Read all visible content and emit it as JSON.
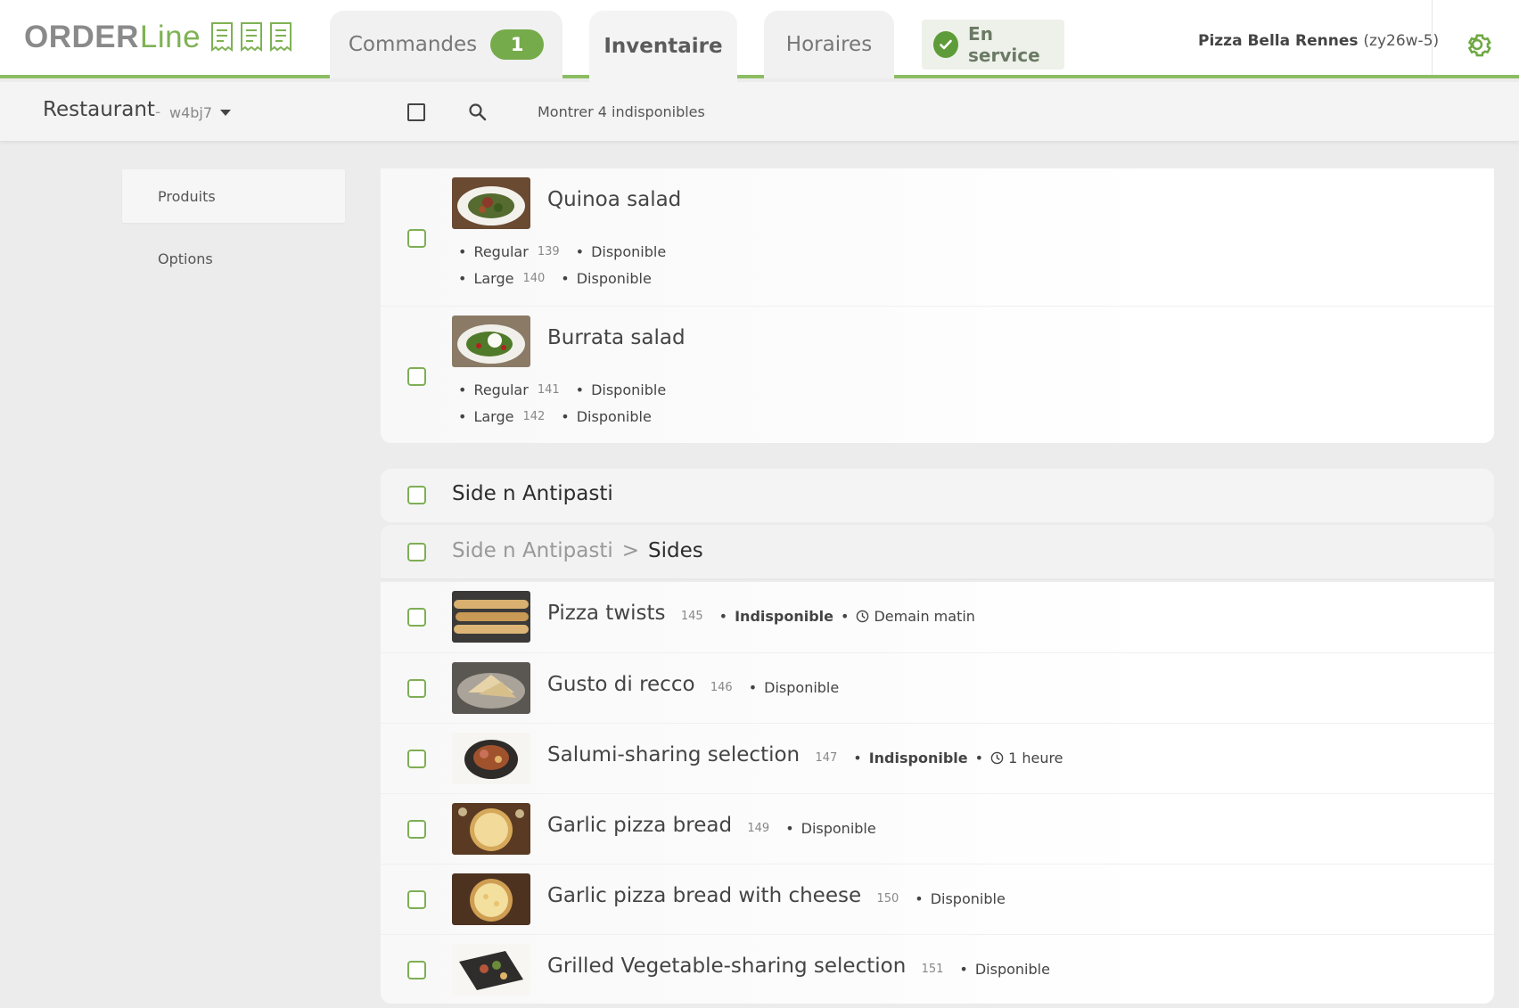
{
  "brand": {
    "logo_order": "ORDER",
    "logo_line": "Line",
    "logo_icon": "receipt-tickets-icon"
  },
  "colors": {
    "accent": "#7eb254",
    "accent_dark": "#5e9c3a",
    "background": "#ececec"
  },
  "tabs": [
    {
      "label": "Commandes",
      "badge": "1"
    },
    {
      "label": "Inventaire"
    },
    {
      "label": "Horaires"
    }
  ],
  "status": {
    "label": "En service",
    "icon": "check-circle-icon"
  },
  "account": {
    "name": "Pizza Bella Rennes",
    "code": "(zy26w-5)",
    "settings_icon": "gear-icon"
  },
  "subbar": {
    "store": "Restaurant",
    "separator": "-",
    "store_code": "w4bj7",
    "show_unavailable": "Montrer 4 indisponibles"
  },
  "sidebar": {
    "items": [
      {
        "label": "Produits"
      },
      {
        "label": "Options"
      }
    ]
  },
  "products_top": [
    {
      "name": "Quinoa salad",
      "variants": [
        {
          "size": "Regular",
          "id": "139",
          "status": "Disponible"
        },
        {
          "size": "Large",
          "id": "140",
          "status": "Disponible"
        }
      ]
    },
    {
      "name": "Burrata salad",
      "variants": [
        {
          "size": "Regular",
          "id": "141",
          "status": "Disponible"
        },
        {
          "size": "Large",
          "id": "142",
          "status": "Disponible"
        }
      ]
    }
  ],
  "category": {
    "title": "Side n Antipasti",
    "subcategory": "Sides",
    "crumb_sep": ">"
  },
  "sides": [
    {
      "name": "Pizza twists",
      "id": "145",
      "status": "Indisponible",
      "until": "Demain matin"
    },
    {
      "name": "Gusto di recco",
      "id": "146",
      "status": "Disponible"
    },
    {
      "name": "Salumi-sharing selection",
      "id": "147",
      "status": "Indisponible",
      "until": "1 heure"
    },
    {
      "name": "Garlic pizza bread",
      "id": "149",
      "status": "Disponible"
    },
    {
      "name": "Garlic pizza bread with cheese",
      "id": "150",
      "status": "Disponible"
    },
    {
      "name": "Grilled Vegetable-sharing selection",
      "id": "151",
      "status": "Disponible"
    }
  ]
}
